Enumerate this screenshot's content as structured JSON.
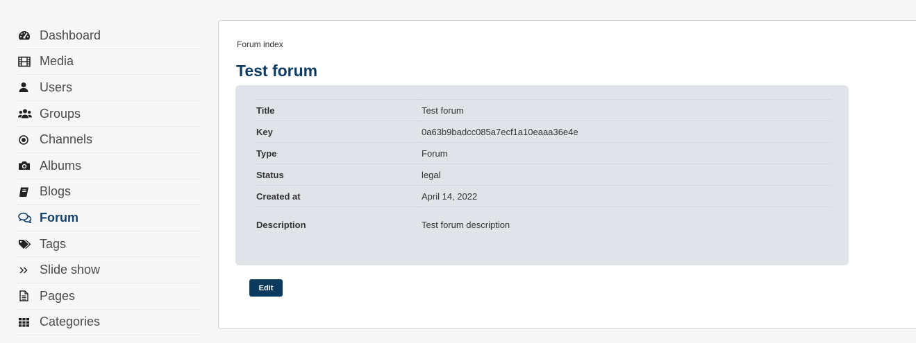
{
  "sidebar": {
    "items": [
      {
        "label": "Dashboard",
        "icon": "tachometer-icon"
      },
      {
        "label": "Media",
        "icon": "film-icon"
      },
      {
        "label": "Users",
        "icon": "user-icon"
      },
      {
        "label": "Groups",
        "icon": "users-icon"
      },
      {
        "label": "Channels",
        "icon": "dot-circle-icon"
      },
      {
        "label": "Albums",
        "icon": "camera-icon"
      },
      {
        "label": "Blogs",
        "icon": "book-icon"
      },
      {
        "label": "Forum",
        "icon": "comments-icon",
        "active": true
      },
      {
        "label": "Tags",
        "icon": "tags-icon"
      },
      {
        "label": "Slide show",
        "icon": "double-angle-right-icon"
      },
      {
        "label": "Pages",
        "icon": "file-text-icon"
      },
      {
        "label": "Categories",
        "icon": "grid-icon"
      }
    ]
  },
  "main": {
    "breadcrumb": "Forum index",
    "title": "Test forum",
    "details": {
      "title_label": "Title",
      "title_value": "Test forum",
      "key_label": "Key",
      "key_value": "0a63b9badcc085a7ecf1a10eaaa36e4e",
      "type_label": "Type",
      "type_value": "Forum",
      "status_label": "Status",
      "status_value": "legal",
      "created_label": "Created at",
      "created_value": "April 14, 2022",
      "description_label": "Description",
      "description_value": "Test forum description"
    },
    "edit_label": "Edit"
  },
  "colors": {
    "accent": "#0d3b63",
    "button": "#0b3a5e",
    "info_box": "#e0e3e8"
  }
}
